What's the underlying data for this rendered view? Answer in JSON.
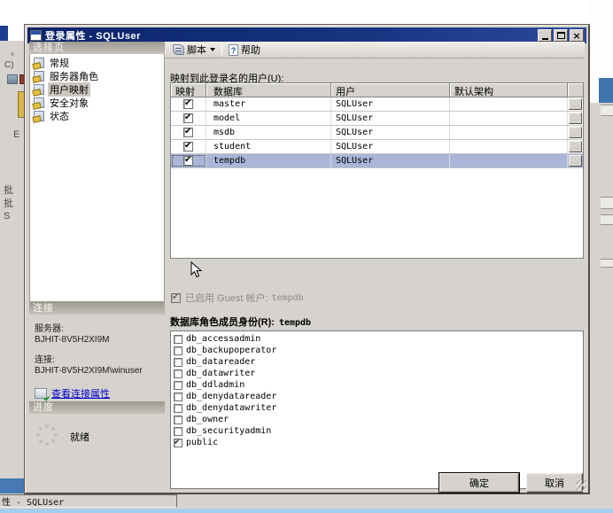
{
  "colors": {
    "titlebar": "#0a246a",
    "dialog_face": "#d6d3ce",
    "selection_row": "#aab6d8",
    "link": "#0000cc",
    "taskbar_blue": "#4779b4",
    "bottom_strip": "#a8cdea"
  },
  "window": {
    "title": "登录属性 - SQLUser"
  },
  "dialog_toolbar": {
    "script_label": "脚本",
    "help_label": "帮助",
    "help_icon_glyph": "?"
  },
  "sidebar": {
    "header": "选择页",
    "items": [
      {
        "key": "general",
        "label": "常规",
        "selected": false
      },
      {
        "key": "server-roles",
        "label": "服务器角色",
        "selected": false
      },
      {
        "key": "user-mapping",
        "label": "用户映射",
        "selected": true
      },
      {
        "key": "securables",
        "label": "安全对象",
        "selected": false
      },
      {
        "key": "status",
        "label": "状态",
        "selected": false
      }
    ]
  },
  "connection_panel": {
    "header": "连接",
    "server_label": "服务器:",
    "server_value": "BJHIT-8V5H2XI9M",
    "connection_label": "连接:",
    "connection_value": "BJHIT-8V5H2XI9M\\winuser",
    "view_link": "查看连接属性"
  },
  "progress_panel": {
    "header": "进度",
    "status": "就绪"
  },
  "main": {
    "users_label": "映射到此登录名的用户(U):",
    "table": {
      "headers": [
        "映射",
        "数据库",
        "用户",
        "默认架构"
      ],
      "browse_label": "...",
      "rows": [
        {
          "mapped": true,
          "database": "master",
          "user": "SQLUser",
          "schema": "",
          "selected": false
        },
        {
          "mapped": true,
          "database": "model",
          "user": "SQLUser",
          "schema": "",
          "selected": false
        },
        {
          "mapped": true,
          "database": "msdb",
          "user": "SQLUser",
          "schema": "",
          "selected": false
        },
        {
          "mapped": true,
          "database": "student",
          "user": "SQLUser",
          "schema": "",
          "selected": false
        },
        {
          "mapped": true,
          "database": "tempdb",
          "user": "SQLUser",
          "schema": "",
          "selected": true
        }
      ]
    },
    "guest_label": "已启用 Guest 帐户:",
    "guest_value": "tempdb",
    "guest_checked": true,
    "roles_label": "数据库角色成员身份(R):",
    "roles_db": "tempdb",
    "roles": [
      {
        "name": "db_accessadmin",
        "checked": false
      },
      {
        "name": "db_backupoperator",
        "checked": false
      },
      {
        "name": "db_datareader",
        "checked": false
      },
      {
        "name": "db_datawriter",
        "checked": false
      },
      {
        "name": "db_ddladmin",
        "checked": false
      },
      {
        "name": "db_denydatareader",
        "checked": false
      },
      {
        "name": "db_denydatawriter",
        "checked": false
      },
      {
        "name": "db_owner",
        "checked": false
      },
      {
        "name": "db_securityadmin",
        "checked": false
      },
      {
        "name": "public",
        "checked": true
      }
    ]
  },
  "footer": {
    "ok_label": "确定",
    "cancel_label": "取消"
  },
  "taskbar": {
    "button_text": "性 - SQLUser"
  },
  "background": {
    "left_fragments": [
      "。",
      "C)",
      "E",
      "批",
      "批",
      "S"
    ]
  }
}
